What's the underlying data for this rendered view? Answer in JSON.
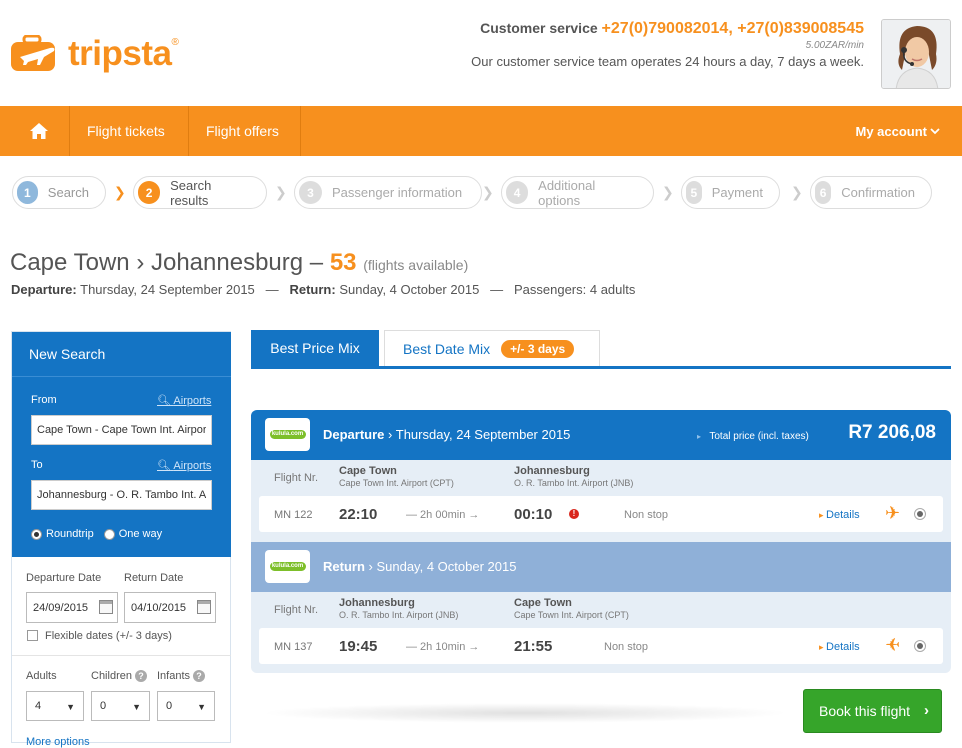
{
  "brand": {
    "name": "tripsta",
    "reg": "®",
    "accent": "#f7901e",
    "blue": "#1474c4",
    "green": "#36a52a"
  },
  "header": {
    "cs_label": "Customer service",
    "cs_phones": "+27(0)790082014, +27(0)839008545",
    "cs_rate": "5.00ZAR/min",
    "cs_hours": "Our customer service team operates 24 hours a day, 7 days a week.",
    "agent_icon": "customer-service-agent-photo"
  },
  "nav": {
    "home_icon": "home-icon",
    "flight_tickets": "Flight tickets",
    "flight_offers": "Flight offers",
    "my_account": "My account"
  },
  "steps": [
    {
      "num": "1",
      "label": "Search",
      "state": "done"
    },
    {
      "num": "2",
      "label": "Search results",
      "state": "active"
    },
    {
      "num": "3",
      "label": "Passenger information",
      "state": "todo"
    },
    {
      "num": "4",
      "label": "Additional options",
      "state": "todo"
    },
    {
      "num": "5",
      "label": "Payment",
      "state": "todo"
    },
    {
      "num": "6",
      "label": "Confirmation",
      "state": "todo"
    }
  ],
  "route": {
    "from": "Cape Town",
    "to": "Johannesburg",
    "sep": "›",
    "dash": "–",
    "count": "53",
    "avail": "(flights available)",
    "departure_label": "Departure:",
    "departure_value": "Thursday, 24 September 2015",
    "return_label": "Return:",
    "return_value": "Sunday, 4 October 2015",
    "passengers": "Passengers: 4 adults",
    "em_dash": "—"
  },
  "search": {
    "title": "New Search",
    "from_label": "From",
    "to_label": "To",
    "airports_link": "Airports",
    "from_value": "Cape Town - Cape Town Int. Airport",
    "to_value": "Johannesburg - O. R. Tambo Int. Airport",
    "roundtrip": "Roundtrip",
    "oneway": "One way",
    "departure_date_label": "Departure Date",
    "return_date_label": "Return Date",
    "departure_date": "24/09/2015",
    "return_date": "04/10/2015",
    "flexible": "Flexible dates (+/- 3 days)",
    "adults_label": "Adults",
    "children_label": "Children",
    "infants_label": "Infants",
    "help": "?",
    "adults": "4",
    "children": "0",
    "infants": "0",
    "more_options": "More options"
  },
  "tabs": {
    "best_price": "Best Price Mix",
    "best_date": "Best Date Mix",
    "badge": "+/- 3 days"
  },
  "result": {
    "airline": "kulula.com",
    "total_label": "Total price (incl. taxes)",
    "total_price": "R7 206,08",
    "flight_nr_label": "Flight Nr.",
    "details": "Details",
    "departure": {
      "label": "Departure",
      "date": "Thursday, 24 September 2015",
      "from_city": "Cape Town",
      "from_airport": "Cape Town Int. Airport (CPT)",
      "to_city": "Johannesburg",
      "to_airport": "O. R. Tambo Int. Airport (JNB)",
      "code": "MN 122",
      "dep_time": "22:10",
      "duration": "— 2h 00min →",
      "arr_time": "00:10",
      "stops": "Non stop",
      "warn": "!"
    },
    "return": {
      "label": "Return",
      "date": "Sunday, 4 October 2015",
      "from_city": "Johannesburg",
      "from_airport": "O. R. Tambo Int. Airport (JNB)",
      "to_city": "Cape Town",
      "to_airport": "Cape Town Int. Airport (CPT)",
      "code": "MN 137",
      "dep_time": "19:45",
      "duration": "— 2h 10min →",
      "arr_time": "21:55",
      "stops": "Non stop"
    }
  },
  "book": {
    "label": "Book this flight",
    "chevron": "›"
  }
}
